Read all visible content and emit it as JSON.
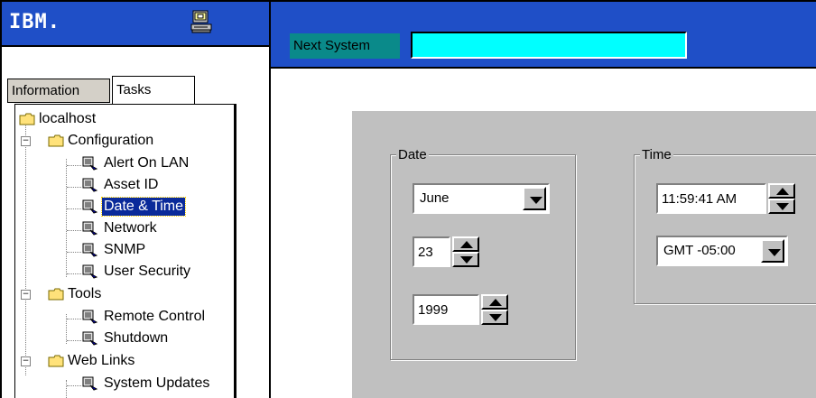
{
  "brand": {
    "logo_text": "IBM."
  },
  "tabs": [
    {
      "label": "Information"
    },
    {
      "label": "Tasks"
    }
  ],
  "tree": {
    "root": "localhost",
    "configuration": "Configuration",
    "alert_on_lan": "Alert On LAN",
    "asset_id": "Asset ID",
    "date_time": "Date & Time",
    "network": "Network",
    "snmp": "SNMP",
    "user_security": "User Security",
    "tools": "Tools",
    "remote_control": "Remote Control",
    "shutdown": "Shutdown",
    "web_links": "Web Links",
    "system_updates": "System Updates"
  },
  "header": {
    "next_system_label": "Next System",
    "next_system_value": ""
  },
  "date": {
    "legend": "Date",
    "month": "June",
    "day": "23",
    "year": "1999"
  },
  "time": {
    "legend": "Time",
    "clock": "11:59:41 AM",
    "timezone": "GMT -05:00"
  },
  "colors": {
    "brand_blue": "#1f4fc7",
    "next_system_bg": "#0a8a8a",
    "input_cyan": "#00ffff",
    "panel_gray": "#c0c0c0"
  }
}
